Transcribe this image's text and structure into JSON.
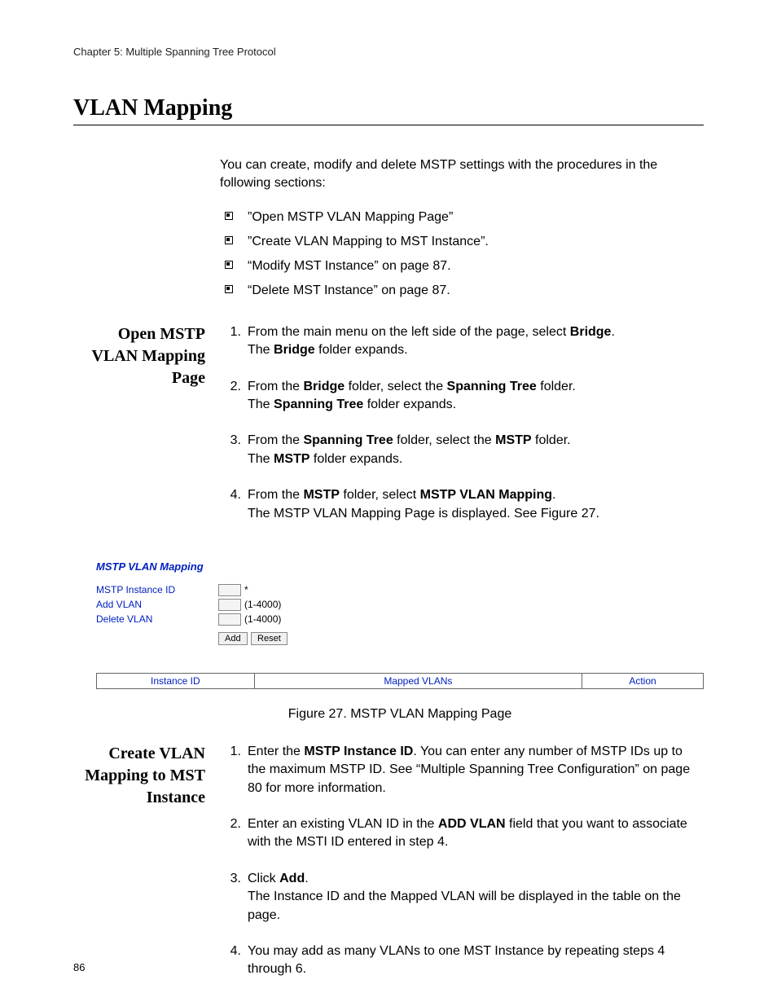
{
  "chapter": "Chapter 5: Multiple Spanning Tree Protocol",
  "section_title": "VLAN Mapping",
  "intro": "You can create, modify and delete MSTP settings with the procedures in the following sections:",
  "bullets": [
    "”Open MSTP VLAN Mapping Page”",
    "”Create VLAN Mapping to MST Instance”.",
    "“Modify MST Instance” on page 87.",
    "“Delete MST Instance” on page 87."
  ],
  "side_open": "Open MSTP VLAN Mapping Page",
  "open_steps": {
    "l1a": "From the main menu on the left side of the page, select ",
    "l1b": "Bridge",
    "l1c": ".",
    "l1d": "The ",
    "l1e": "Bridge",
    "l1f": " folder expands.",
    "l2a": "From the ",
    "l2b": "Bridge",
    "l2c": " folder, select the ",
    "l2d": "Spanning Tree",
    "l2e": " folder.",
    "l2f": "The ",
    "l2g": "Spanning Tree",
    "l2h": " folder expands.",
    "l3a": "From the ",
    "l3b": "Spanning Tree",
    "l3c": " folder, select the ",
    "l3d": "MSTP",
    "l3e": " folder.",
    "l3f": "The ",
    "l3g": "MSTP",
    "l3h": " folder expands.",
    "l4a": "From the ",
    "l4b": "MSTP",
    "l4c": " folder, select ",
    "l4d": "MSTP VLAN Mapping",
    "l4e": ".",
    "l4f": "The MSTP VLAN Mapping Page is displayed. See Figure 27."
  },
  "figure": {
    "title": "MSTP VLAN Mapping",
    "row1_label": "MSTP Instance ID",
    "row1_suffix": "*",
    "row2_label": "Add VLAN",
    "row2_suffix": "(1-4000)",
    "row3_label": "Delete VLAN",
    "row3_suffix": "(1-4000)",
    "btn_add": "Add",
    "btn_reset": "Reset",
    "col_instance": "Instance ID",
    "col_mapped": "Mapped VLANs",
    "col_action": "Action",
    "caption": "Figure 27. MSTP VLAN Mapping Page"
  },
  "side_create": "Create VLAN Mapping to MST Instance",
  "create_steps": {
    "l1a": "Enter the ",
    "l1b": "MSTP Instance ID",
    "l1c": ". You can enter any number of MSTP IDs up to the maximum MSTP ID. See “Multiple Spanning Tree Configuration” on page 80 for more information.",
    "l2a": "Enter an existing VLAN ID in the ",
    "l2b": "ADD VLAN",
    "l2c": " field that you want to associate with the MSTI ID entered in step 4.",
    "l3a": "Click ",
    "l3b": "Add",
    "l3c": ".",
    "l3d": "The Instance ID and the Mapped VLAN will be displayed in the table on the page.",
    "l4": "You may add as many VLANs to one MST Instance by repeating steps 4 through 6."
  },
  "page_number": "86"
}
